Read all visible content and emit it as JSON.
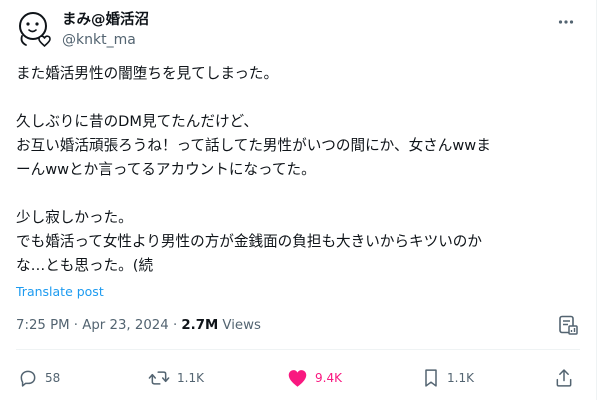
{
  "author": {
    "display_name": "まみ@婚活沼",
    "handle": "@knkt_ma",
    "avatar_icon": "cartoon-face-heart-icon"
  },
  "tweet": {
    "lines": [
      "また婚活男性の闇堕ちを見てしまった。",
      "",
      "久しぶりに昔のDM見てたんだけど、",
      "お互い婚活頑張ろうね！って話してた男性がいつの間にか、女さんwwま",
      "ーんwwとか言ってるアカウントになってた。",
      "",
      "少し寂しかった。",
      "でも婚活って女性より男性の方が金銭面の負担も大きいからキツいのか",
      "な…とも思った。(続"
    ],
    "translate_label": "Translate post"
  },
  "meta": {
    "time": "7:25 PM",
    "separator": " · ",
    "date": "Apr 23, 2024",
    "views_count": "2.7M",
    "views_label": " Views"
  },
  "actions": {
    "replies": "58",
    "reposts": "1.1K",
    "likes": "9.4K",
    "bookmarks": "1.1K"
  },
  "colors": {
    "accent": "#1d9bf0",
    "like": "#f91880",
    "secondary_text": "#536471",
    "text": "#0f1419"
  }
}
